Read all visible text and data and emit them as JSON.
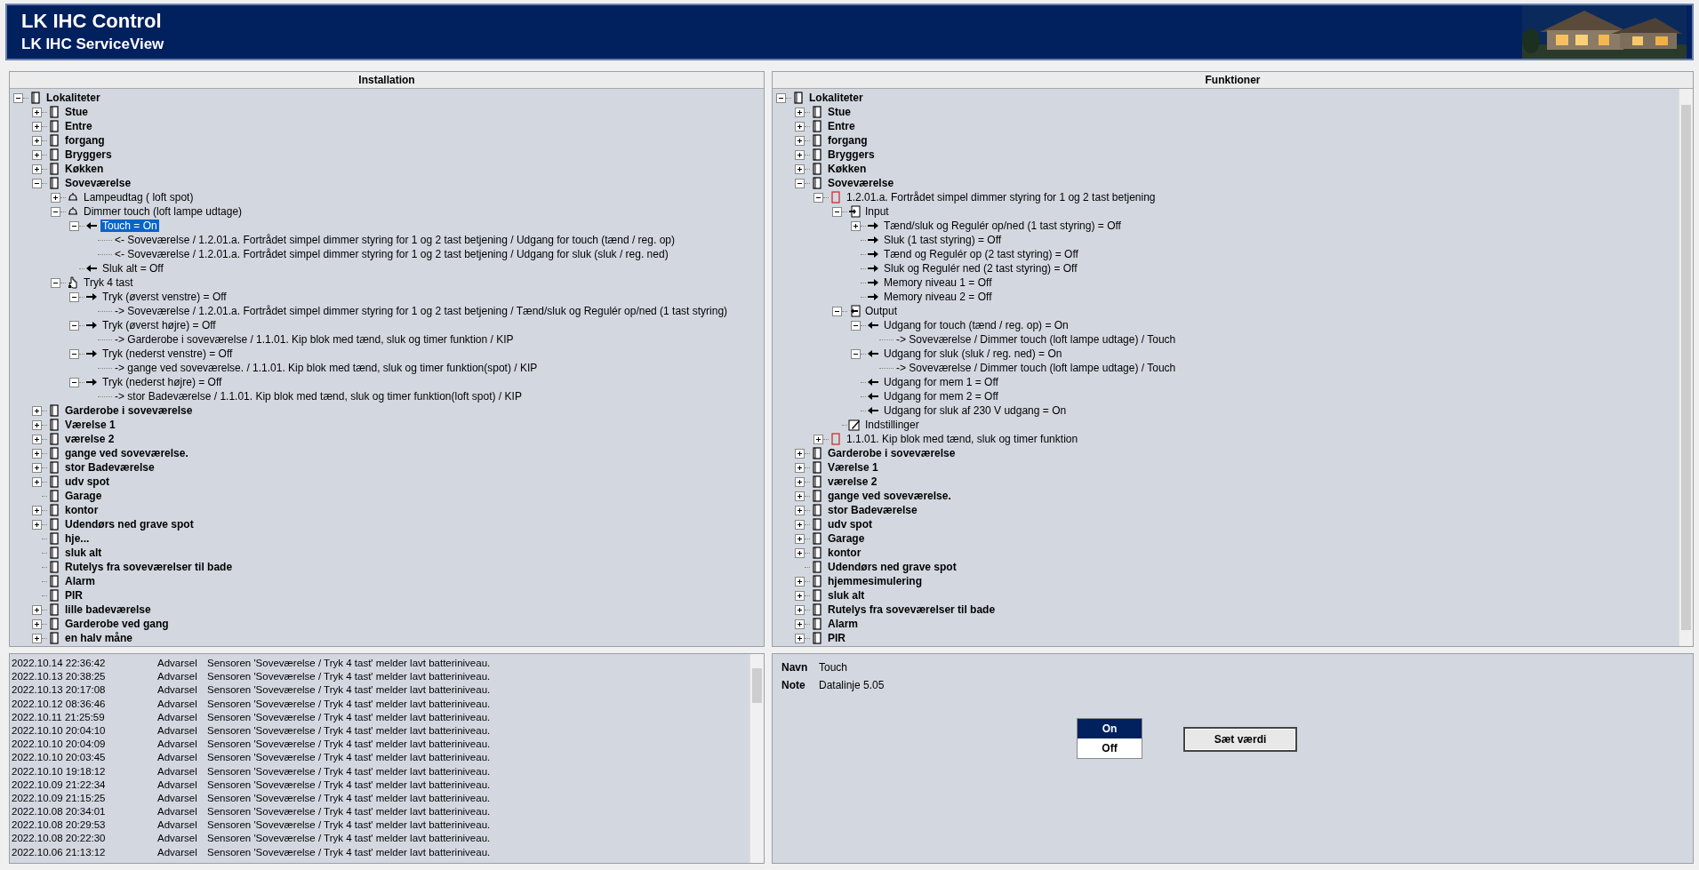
{
  "header": {
    "title": "LK IHC Control",
    "subtitle": "LK IHC ServiceView"
  },
  "installation": {
    "title": "Installation",
    "tree": [
      {
        "label": "Lokaliteter",
        "kind": "root",
        "expanded": true,
        "selected": false,
        "children": [
          {
            "label": "Stue",
            "kind": "room",
            "expanded": false,
            "selected": false
          },
          {
            "label": "Entre",
            "kind": "room",
            "expanded": false,
            "selected": false
          },
          {
            "label": "forgang",
            "kind": "room",
            "expanded": false,
            "selected": false
          },
          {
            "label": "Bryggers",
            "kind": "room",
            "expanded": false,
            "selected": false
          },
          {
            "label": "Køkken",
            "kind": "room",
            "expanded": false,
            "selected": false
          },
          {
            "label": "Soveværelse",
            "kind": "room",
            "expanded": true,
            "selected": false,
            "children": [
              {
                "label": "Lampeudtag ( loft spot)",
                "kind": "lamp",
                "expanded": false,
                "selected": false
              },
              {
                "label": "Dimmer touch (loft lampe udtage)",
                "kind": "lamp",
                "expanded": true,
                "selected": false,
                "children": [
                  {
                    "label": "Touch = On",
                    "kind": "output",
                    "expanded": true,
                    "selected": true,
                    "children": [
                      {
                        "label": "<- Soveværelse / 1.2.01.a. Fortrådet simpel dimmer styring for 1 og 2 tast betjening / Udgang for touch (tænd / reg. op)",
                        "kind": "link",
                        "selected": false
                      },
                      {
                        "label": "<- Soveværelse / 1.2.01.a. Fortrådet simpel dimmer styring for 1 og 2 tast betjening / Udgang for sluk (sluk / reg. ned)",
                        "kind": "link",
                        "selected": false
                      }
                    ]
                  },
                  {
                    "label": "Sluk alt = Off",
                    "kind": "output",
                    "selected": false
                  }
                ]
              },
              {
                "label": "Tryk 4 tast",
                "kind": "keypad",
                "expanded": true,
                "selected": false,
                "children": [
                  {
                    "label": "Tryk (øverst venstre) = Off",
                    "kind": "input",
                    "expanded": true,
                    "selected": false,
                    "children": [
                      {
                        "label": "-> Soveværelse / 1.2.01.a. Fortrådet simpel dimmer styring for 1 og 2 tast betjening / Tænd/sluk og Regulér op/ned (1 tast styring)",
                        "kind": "link",
                        "selected": false
                      }
                    ]
                  },
                  {
                    "label": "Tryk (øverst højre) = Off",
                    "kind": "input",
                    "expanded": true,
                    "selected": false,
                    "children": [
                      {
                        "label": "-> Garderobe i soveværelse / 1.1.01. Kip blok med tænd, sluk og timer funktion / KIP",
                        "kind": "link",
                        "selected": false
                      }
                    ]
                  },
                  {
                    "label": "Tryk (nederst venstre) = Off",
                    "kind": "input",
                    "expanded": true,
                    "selected": false,
                    "children": [
                      {
                        "label": "-> gange ved soveværelse. / 1.1.01. Kip blok med tænd, sluk og timer funktion(spot) / KIP",
                        "kind": "link",
                        "selected": false
                      }
                    ]
                  },
                  {
                    "label": "Tryk (nederst højre) = Off",
                    "kind": "input",
                    "expanded": true,
                    "selected": false,
                    "children": [
                      {
                        "label": "-> stor Badeværelse / 1.1.01. Kip blok med tænd, sluk og timer funktion(loft spot) / KIP",
                        "kind": "link",
                        "selected": false
                      }
                    ]
                  }
                ]
              }
            ]
          },
          {
            "label": "Garderobe i soveværelse",
            "kind": "room",
            "expanded": false,
            "selected": false
          },
          {
            "label": "Værelse 1",
            "kind": "room",
            "expanded": false,
            "selected": false
          },
          {
            "label": "værelse 2",
            "kind": "room",
            "expanded": false,
            "selected": false
          },
          {
            "label": "gange ved soveværelse.",
            "kind": "room",
            "expanded": false,
            "selected": false
          },
          {
            "label": "stor Badeværelse",
            "kind": "room",
            "expanded": false,
            "selected": false
          },
          {
            "label": "udv spot",
            "kind": "room",
            "expanded": false,
            "selected": false
          },
          {
            "label": "Garage",
            "kind": "room",
            "selected": false
          },
          {
            "label": "kontor",
            "kind": "room",
            "expanded": false,
            "selected": false
          },
          {
            "label": "Udendørs ned grave spot",
            "kind": "room",
            "expanded": false,
            "selected": false
          },
          {
            "label": "hje...",
            "kind": "room",
            "selected": false
          },
          {
            "label": "sluk alt",
            "kind": "room",
            "selected": false
          },
          {
            "label": "Rutelys fra soveværelser til bade",
            "kind": "room",
            "selected": false
          },
          {
            "label": "Alarm",
            "kind": "room",
            "selected": false
          },
          {
            "label": "PIR",
            "kind": "room",
            "selected": false
          },
          {
            "label": "lille badeværelse",
            "kind": "room",
            "expanded": false,
            "selected": false
          },
          {
            "label": "Garderobe ved gang",
            "kind": "room",
            "expanded": false,
            "selected": false
          },
          {
            "label": "en halv måne",
            "kind": "room",
            "expanded": false,
            "selected": false
          }
        ]
      }
    ]
  },
  "functions": {
    "title": "Funktioner",
    "tree": [
      {
        "label": "Lokaliteter",
        "kind": "root",
        "expanded": true,
        "selected": false,
        "children": [
          {
            "label": "Stue",
            "kind": "room",
            "expanded": false,
            "selected": false
          },
          {
            "label": "Entre",
            "kind": "room",
            "expanded": false,
            "selected": false
          },
          {
            "label": "forgang",
            "kind": "room",
            "expanded": false,
            "selected": false
          },
          {
            "label": "Bryggers",
            "kind": "room",
            "expanded": false,
            "selected": false
          },
          {
            "label": "Køkken",
            "kind": "room",
            "expanded": false,
            "selected": false
          },
          {
            "label": "Soveværelse",
            "kind": "room",
            "expanded": true,
            "selected": false,
            "children": [
              {
                "label": "1.2.01.a. Fortrådet simpel dimmer styring for 1 og 2 tast betjening",
                "kind": "module",
                "expanded": true,
                "selected": false,
                "children": [
                  {
                    "label": "Input",
                    "kind": "input-group",
                    "expanded": true,
                    "selected": false,
                    "children": [
                      {
                        "label": "Tænd/sluk og Regulér op/ned (1 tast styring) = Off",
                        "kind": "input",
                        "expanded": false,
                        "selected": false
                      },
                      {
                        "label": "Sluk (1 tast styring) = Off",
                        "kind": "input",
                        "selected": false
                      },
                      {
                        "label": "Tænd og Regulér op (2 tast styring) = Off",
                        "kind": "input",
                        "selected": false
                      },
                      {
                        "label": "Sluk og Regulér ned (2 tast styring) = Off",
                        "kind": "input",
                        "selected": false
                      },
                      {
                        "label": "Memory niveau 1 = Off",
                        "kind": "input",
                        "selected": false
                      },
                      {
                        "label": "Memory niveau 2 = Off",
                        "kind": "input",
                        "selected": false
                      }
                    ]
                  },
                  {
                    "label": "Output",
                    "kind": "output-group",
                    "expanded": true,
                    "selected": false,
                    "children": [
                      {
                        "label": "Udgang for touch (tænd / reg. op) = On",
                        "kind": "output",
                        "expanded": true,
                        "selected": false,
                        "children": [
                          {
                            "label": "-> Soveværelse / Dimmer touch (loft lampe udtage) / Touch",
                            "kind": "link",
                            "selected": false
                          }
                        ]
                      },
                      {
                        "label": "Udgang for sluk (sluk / reg. ned) = On",
                        "kind": "output",
                        "expanded": true,
                        "selected": false,
                        "children": [
                          {
                            "label": "-> Soveværelse / Dimmer touch (loft lampe udtage) / Touch",
                            "kind": "link",
                            "selected": false
                          }
                        ]
                      },
                      {
                        "label": "Udgang for mem 1 = Off",
                        "kind": "output",
                        "selected": false
                      },
                      {
                        "label": "Udgang for mem 2 = Off",
                        "kind": "output",
                        "selected": false
                      },
                      {
                        "label": "Udgang for sluk af 230 V udgang = On",
                        "kind": "output",
                        "selected": false
                      }
                    ]
                  },
                  {
                    "label": "Indstillinger",
                    "kind": "settings",
                    "selected": false
                  }
                ]
              },
              {
                "label": "1.1.01. Kip blok med tænd, sluk og timer funktion",
                "kind": "module",
                "expanded": false,
                "selected": false
              }
            ]
          },
          {
            "label": "Garderobe i soveværelse",
            "kind": "room",
            "expanded": false,
            "selected": false
          },
          {
            "label": "Værelse 1",
            "kind": "room",
            "expanded": false,
            "selected": false
          },
          {
            "label": "værelse 2",
            "kind": "room",
            "expanded": false,
            "selected": false
          },
          {
            "label": "gange ved soveværelse.",
            "kind": "room",
            "expanded": false,
            "selected": false
          },
          {
            "label": "stor Badeværelse",
            "kind": "room",
            "expanded": false,
            "selected": false
          },
          {
            "label": "udv spot",
            "kind": "room",
            "expanded": false,
            "selected": false
          },
          {
            "label": "Garage",
            "kind": "room",
            "expanded": false,
            "selected": false
          },
          {
            "label": "kontor",
            "kind": "room",
            "expanded": false,
            "selected": false
          },
          {
            "label": "Udendørs ned grave spot",
            "kind": "room",
            "selected": false
          },
          {
            "label": "hjemmesimulering",
            "kind": "room",
            "expanded": false,
            "selected": false
          },
          {
            "label": "sluk alt",
            "kind": "room",
            "expanded": false,
            "selected": false
          },
          {
            "label": "Rutelys fra soveværelser til bade",
            "kind": "room",
            "expanded": false,
            "selected": false
          },
          {
            "label": "Alarm",
            "kind": "room",
            "expanded": false,
            "selected": false
          },
          {
            "label": "PIR",
            "kind": "room",
            "expanded": false,
            "selected": false
          }
        ]
      }
    ]
  },
  "log": [
    {
      "time": "2022.10.14 22:36:42",
      "level": "Advarsel",
      "message": "Sensoren 'Soveværelse / Tryk 4 tast' melder lavt batteriniveau."
    },
    {
      "time": "2022.10.13 20:38:25",
      "level": "Advarsel",
      "message": "Sensoren 'Soveværelse / Tryk 4 tast' melder lavt batteriniveau."
    },
    {
      "time": "2022.10.13 20:17:08",
      "level": "Advarsel",
      "message": "Sensoren 'Soveværelse / Tryk 4 tast' melder lavt batteriniveau."
    },
    {
      "time": "2022.10.12 08:36:46",
      "level": "Advarsel",
      "message": "Sensoren 'Soveværelse / Tryk 4 tast' melder lavt batteriniveau."
    },
    {
      "time": "2022.10.11 21:25:59",
      "level": "Advarsel",
      "message": "Sensoren 'Soveværelse / Tryk 4 tast' melder lavt batteriniveau."
    },
    {
      "time": "2022.10.10 20:04:10",
      "level": "Advarsel",
      "message": "Sensoren 'Soveværelse / Tryk 4 tast' melder lavt batteriniveau."
    },
    {
      "time": "2022.10.10 20:04:09",
      "level": "Advarsel",
      "message": "Sensoren 'Soveværelse / Tryk 4 tast' melder lavt batteriniveau."
    },
    {
      "time": "2022.10.10 20:03:45",
      "level": "Advarsel",
      "message": "Sensoren 'Soveværelse / Tryk 4 tast' melder lavt batteriniveau."
    },
    {
      "time": "2022.10.10 19:18:12",
      "level": "Advarsel",
      "message": "Sensoren 'Soveværelse / Tryk 4 tast' melder lavt batteriniveau."
    },
    {
      "time": "2022.10.09 21:22:34",
      "level": "Advarsel",
      "message": "Sensoren 'Soveværelse / Tryk 4 tast' melder lavt batteriniveau."
    },
    {
      "time": "2022.10.09 21:15:25",
      "level": "Advarsel",
      "message": "Sensoren 'Soveværelse / Tryk 4 tast' melder lavt batteriniveau."
    },
    {
      "time": "2022.10.08 20:34:01",
      "level": "Advarsel",
      "message": "Sensoren 'Soveværelse / Tryk 4 tast' melder lavt batteriniveau."
    },
    {
      "time": "2022.10.08 20:29:53",
      "level": "Advarsel",
      "message": "Sensoren 'Soveværelse / Tryk 4 tast' melder lavt batteriniveau."
    },
    {
      "time": "2022.10.08 20:22:30",
      "level": "Advarsel",
      "message": "Sensoren 'Soveværelse / Tryk 4 tast' melder lavt batteriniveau."
    },
    {
      "time": "2022.10.06 21:13:12",
      "level": "Advarsel",
      "message": "Sensoren 'Soveværelse / Tryk 4 tast' melder lavt batteriniveau."
    }
  ],
  "details": {
    "fields": [
      {
        "label": "Navn",
        "value": "Touch"
      },
      {
        "label": "Note",
        "value": "Datalinje 5.05"
      }
    ],
    "options": [
      {
        "label": "On",
        "selected": true
      },
      {
        "label": "Off",
        "selected": false
      }
    ],
    "button": "Sæt værdi"
  }
}
